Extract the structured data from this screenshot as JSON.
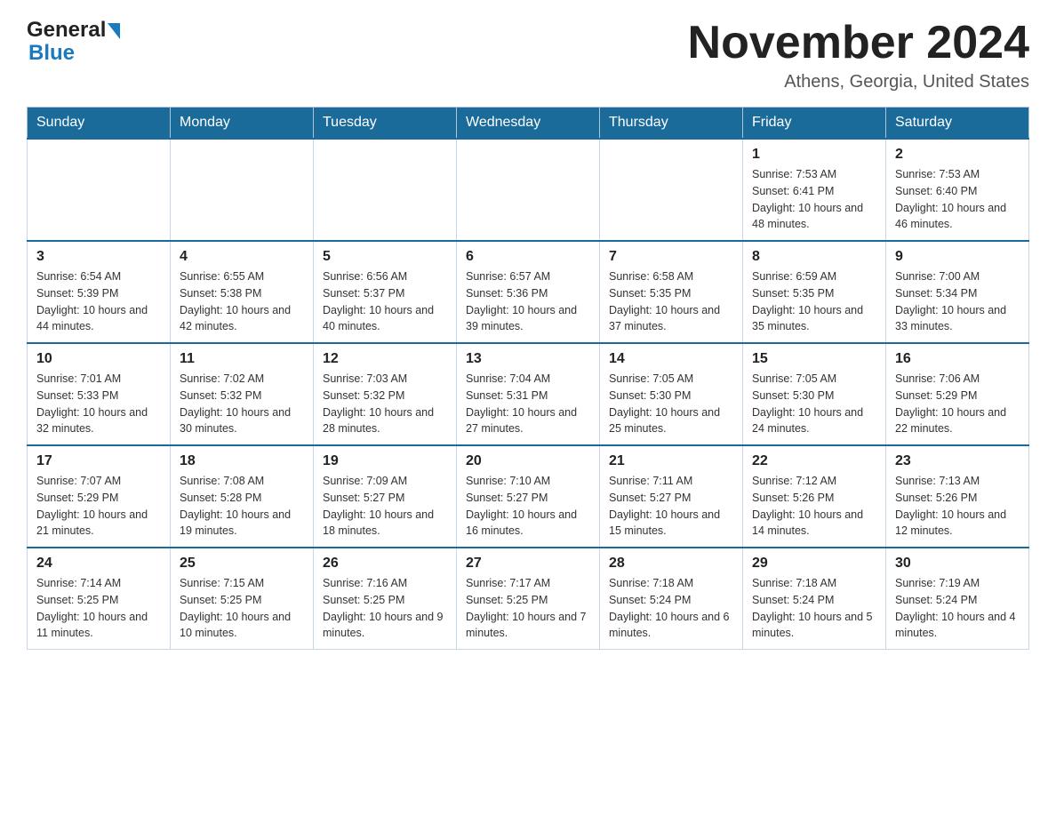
{
  "logo": {
    "general": "General",
    "blue": "Blue"
  },
  "header": {
    "month": "November 2024",
    "location": "Athens, Georgia, United States"
  },
  "days_of_week": [
    "Sunday",
    "Monday",
    "Tuesday",
    "Wednesday",
    "Thursday",
    "Friday",
    "Saturday"
  ],
  "weeks": [
    [
      {
        "day": "",
        "info": ""
      },
      {
        "day": "",
        "info": ""
      },
      {
        "day": "",
        "info": ""
      },
      {
        "day": "",
        "info": ""
      },
      {
        "day": "",
        "info": ""
      },
      {
        "day": "1",
        "info": "Sunrise: 7:53 AM\nSunset: 6:41 PM\nDaylight: 10 hours and 48 minutes."
      },
      {
        "day": "2",
        "info": "Sunrise: 7:53 AM\nSunset: 6:40 PM\nDaylight: 10 hours and 46 minutes."
      }
    ],
    [
      {
        "day": "3",
        "info": "Sunrise: 6:54 AM\nSunset: 5:39 PM\nDaylight: 10 hours and 44 minutes."
      },
      {
        "day": "4",
        "info": "Sunrise: 6:55 AM\nSunset: 5:38 PM\nDaylight: 10 hours and 42 minutes."
      },
      {
        "day": "5",
        "info": "Sunrise: 6:56 AM\nSunset: 5:37 PM\nDaylight: 10 hours and 40 minutes."
      },
      {
        "day": "6",
        "info": "Sunrise: 6:57 AM\nSunset: 5:36 PM\nDaylight: 10 hours and 39 minutes."
      },
      {
        "day": "7",
        "info": "Sunrise: 6:58 AM\nSunset: 5:35 PM\nDaylight: 10 hours and 37 minutes."
      },
      {
        "day": "8",
        "info": "Sunrise: 6:59 AM\nSunset: 5:35 PM\nDaylight: 10 hours and 35 minutes."
      },
      {
        "day": "9",
        "info": "Sunrise: 7:00 AM\nSunset: 5:34 PM\nDaylight: 10 hours and 33 minutes."
      }
    ],
    [
      {
        "day": "10",
        "info": "Sunrise: 7:01 AM\nSunset: 5:33 PM\nDaylight: 10 hours and 32 minutes."
      },
      {
        "day": "11",
        "info": "Sunrise: 7:02 AM\nSunset: 5:32 PM\nDaylight: 10 hours and 30 minutes."
      },
      {
        "day": "12",
        "info": "Sunrise: 7:03 AM\nSunset: 5:32 PM\nDaylight: 10 hours and 28 minutes."
      },
      {
        "day": "13",
        "info": "Sunrise: 7:04 AM\nSunset: 5:31 PM\nDaylight: 10 hours and 27 minutes."
      },
      {
        "day": "14",
        "info": "Sunrise: 7:05 AM\nSunset: 5:30 PM\nDaylight: 10 hours and 25 minutes."
      },
      {
        "day": "15",
        "info": "Sunrise: 7:05 AM\nSunset: 5:30 PM\nDaylight: 10 hours and 24 minutes."
      },
      {
        "day": "16",
        "info": "Sunrise: 7:06 AM\nSunset: 5:29 PM\nDaylight: 10 hours and 22 minutes."
      }
    ],
    [
      {
        "day": "17",
        "info": "Sunrise: 7:07 AM\nSunset: 5:29 PM\nDaylight: 10 hours and 21 minutes."
      },
      {
        "day": "18",
        "info": "Sunrise: 7:08 AM\nSunset: 5:28 PM\nDaylight: 10 hours and 19 minutes."
      },
      {
        "day": "19",
        "info": "Sunrise: 7:09 AM\nSunset: 5:27 PM\nDaylight: 10 hours and 18 minutes."
      },
      {
        "day": "20",
        "info": "Sunrise: 7:10 AM\nSunset: 5:27 PM\nDaylight: 10 hours and 16 minutes."
      },
      {
        "day": "21",
        "info": "Sunrise: 7:11 AM\nSunset: 5:27 PM\nDaylight: 10 hours and 15 minutes."
      },
      {
        "day": "22",
        "info": "Sunrise: 7:12 AM\nSunset: 5:26 PM\nDaylight: 10 hours and 14 minutes."
      },
      {
        "day": "23",
        "info": "Sunrise: 7:13 AM\nSunset: 5:26 PM\nDaylight: 10 hours and 12 minutes."
      }
    ],
    [
      {
        "day": "24",
        "info": "Sunrise: 7:14 AM\nSunset: 5:25 PM\nDaylight: 10 hours and 11 minutes."
      },
      {
        "day": "25",
        "info": "Sunrise: 7:15 AM\nSunset: 5:25 PM\nDaylight: 10 hours and 10 minutes."
      },
      {
        "day": "26",
        "info": "Sunrise: 7:16 AM\nSunset: 5:25 PM\nDaylight: 10 hours and 9 minutes."
      },
      {
        "day": "27",
        "info": "Sunrise: 7:17 AM\nSunset: 5:25 PM\nDaylight: 10 hours and 7 minutes."
      },
      {
        "day": "28",
        "info": "Sunrise: 7:18 AM\nSunset: 5:24 PM\nDaylight: 10 hours and 6 minutes."
      },
      {
        "day": "29",
        "info": "Sunrise: 7:18 AM\nSunset: 5:24 PM\nDaylight: 10 hours and 5 minutes."
      },
      {
        "day": "30",
        "info": "Sunrise: 7:19 AM\nSunset: 5:24 PM\nDaylight: 10 hours and 4 minutes."
      }
    ]
  ]
}
